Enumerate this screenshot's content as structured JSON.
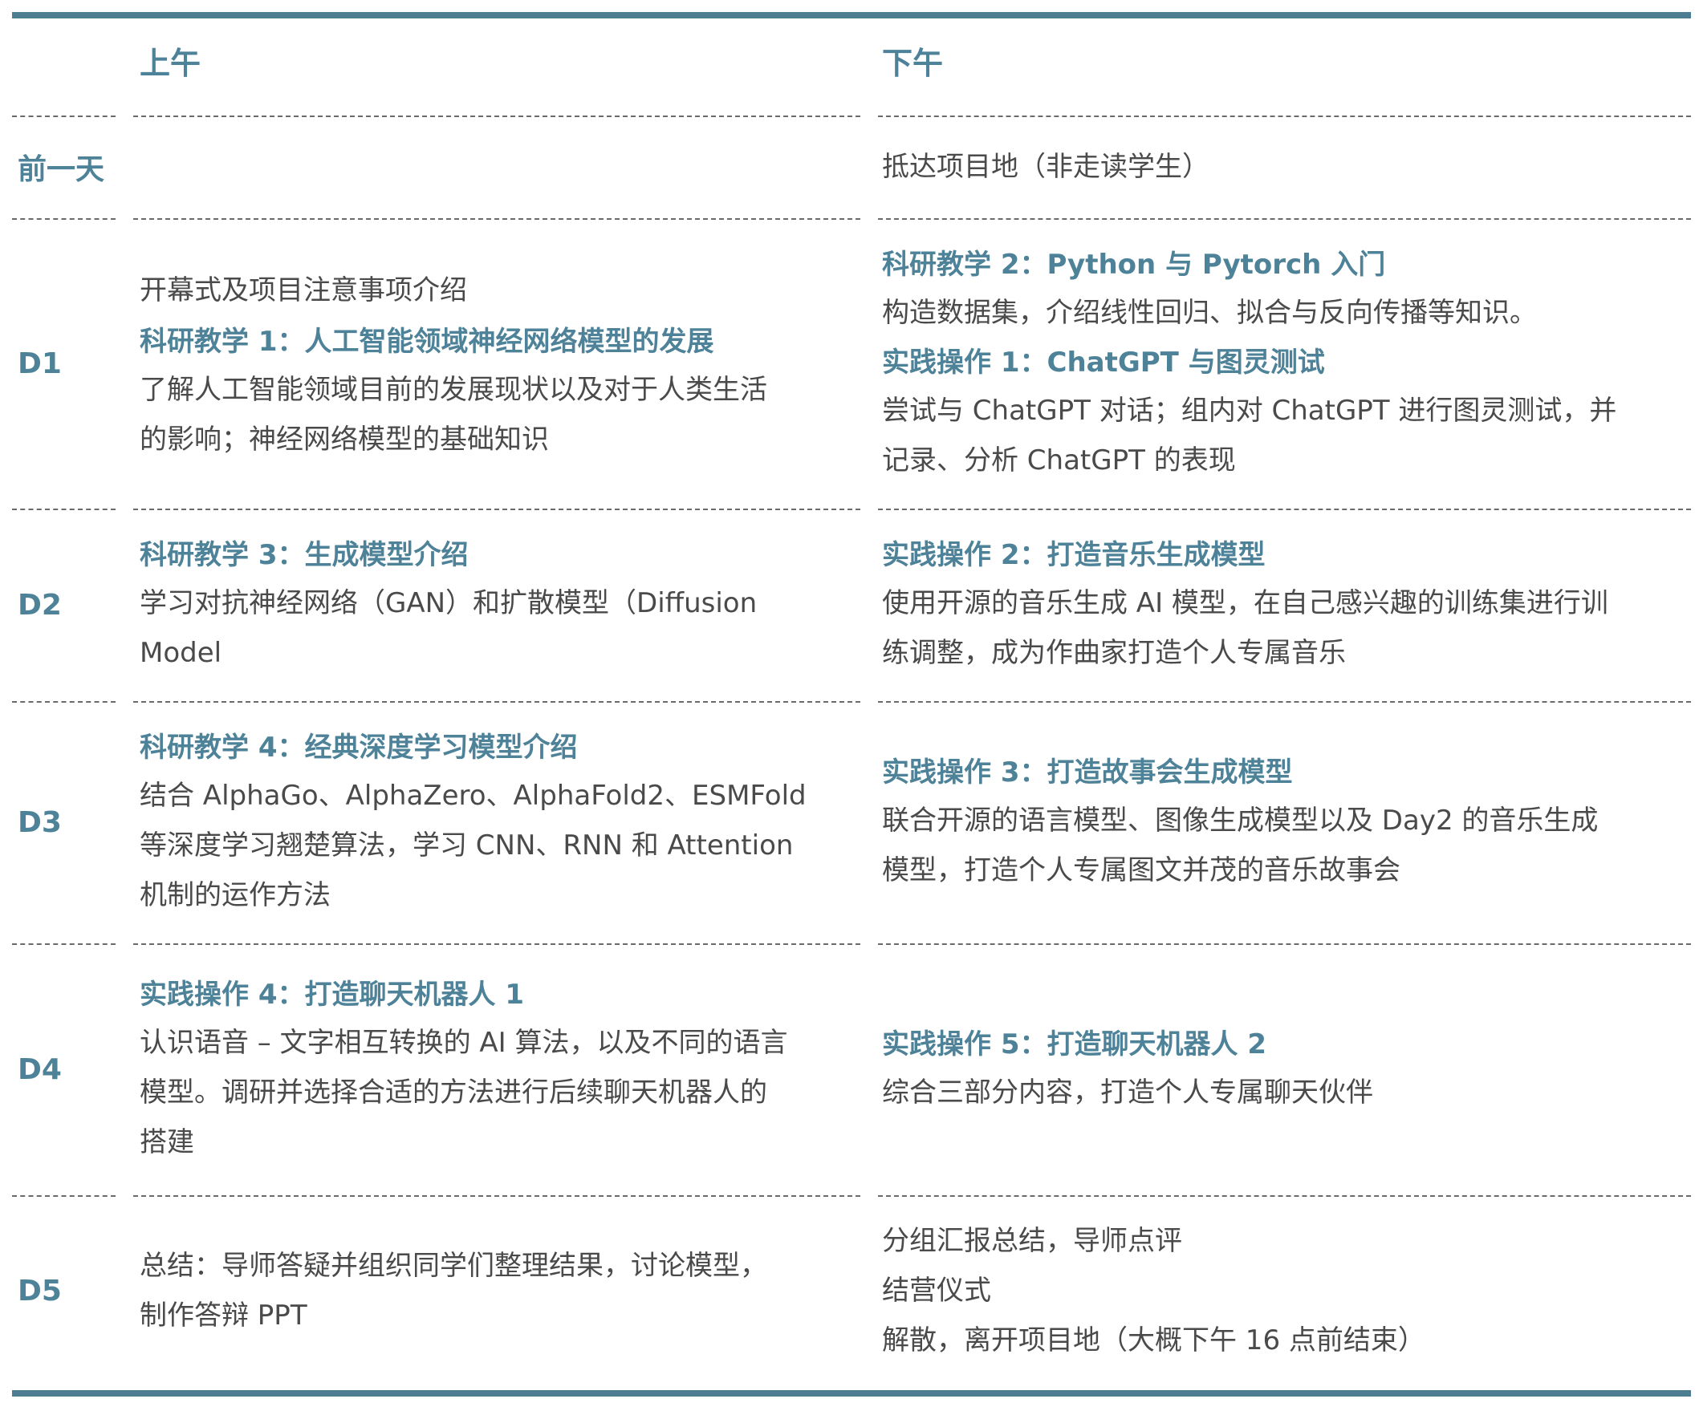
{
  "header": {
    "am_label": "上午",
    "pm_label": "下午"
  },
  "rows": {
    "pre": {
      "day": "前一天",
      "pm": {
        "d1": "抵达项目地（非走读学生）"
      }
    },
    "d1": {
      "day": "D1",
      "am": {
        "d0": "开幕式及项目注意事项介绍",
        "title": "科研教学 1：人工智能领域神经网络模型的发展",
        "d1": "了解人工智能领域目前的发展现状以及对于人类生活",
        "d2": "的影响；神经网络模型的基础知识"
      },
      "pm": {
        "title1": "科研教学 2：Python 与 Pytorch 入门",
        "d1": "构造数据集，介绍线性回归、拟合与反向传播等知识。",
        "title2": "实践操作 1：ChatGPT 与图灵测试",
        "d2": "尝试与 ChatGPT 对话；组内对 ChatGPT 进行图灵测试，并",
        "d3": "记录、分析 ChatGPT 的表现"
      }
    },
    "d2": {
      "day": "D2",
      "am": {
        "title": "科研教学 3：生成模型介绍",
        "d1": "学习对抗神经网络（GAN）和扩散模型（Diffusion",
        "d2": "Model"
      },
      "pm": {
        "title": "实践操作 2：打造音乐生成模型",
        "d1": "使用开源的音乐生成 AI 模型，在自己感兴趣的训练集进行训",
        "d2": "练调整，成为作曲家打造个人专属音乐"
      }
    },
    "d3": {
      "day": "D3",
      "am": {
        "title": "科研教学 4：经典深度学习模型介绍",
        "d1": "结合 AlphaGo、AlphaZero、AlphaFold2、ESMFold",
        "d2": "等深度学习翘楚算法，学习 CNN、RNN 和 Attention",
        "d3": "机制的运作方法"
      },
      "pm": {
        "title": "实践操作 3：打造故事会生成模型",
        "d1": "联合开源的语言模型、图像生成模型以及 Day2 的音乐生成",
        "d2": "模型，打造个人专属图文并茂的音乐故事会"
      }
    },
    "d4": {
      "day": "D4",
      "am": {
        "title": "实践操作 4：打造聊天机器人 1",
        "d1": "认识语音 – 文字相互转换的 AI 算法，以及不同的语言",
        "d2": "模型。调研并选择合适的方法进行后续聊天机器人的",
        "d3": "搭建"
      },
      "pm": {
        "title": "实践操作 5：打造聊天机器人 2",
        "d1": "综合三部分内容，打造个人专属聊天伙伴"
      }
    },
    "d5": {
      "day": "D5",
      "am": {
        "d1": "总结：导师答疑并组织同学们整理结果，讨论模型，",
        "d2": "制作答辩 PPT"
      },
      "pm": {
        "d1": "分组汇报总结，导师点评",
        "d2": "结营仪式",
        "d3": "解散，离开项目地（大概下午 16 点前结束）"
      }
    }
  },
  "colors": {
    "accent": "#4d8298",
    "rule": "#4d7d90",
    "text": "#4a4a4a"
  }
}
